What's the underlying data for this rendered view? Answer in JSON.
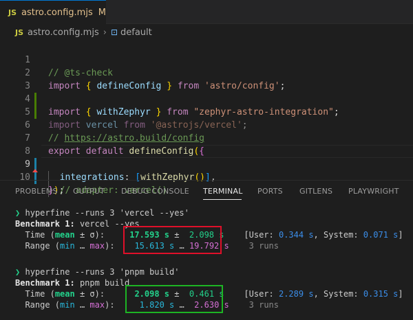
{
  "tab": {
    "name": "astro.config.mjs",
    "modified": "M",
    "js_icon": "JS",
    "close": "×"
  },
  "breadcrumb": {
    "file": "astro.config.mjs",
    "symbol": "default"
  },
  "editor": {
    "lines": [
      {
        "n": "1",
        "comment": "// @ts-check"
      },
      {
        "n": "2",
        "kw_import": "import",
        "brace_open": "{",
        "ident": "defineConfig",
        "brace_close": "}",
        "kw_from": "from",
        "str": "'astro/config'",
        "semi": ";"
      },
      {
        "n": "3",
        "kw_import": "import",
        "brace_open": "{",
        "ident": "withZephyr",
        "brace_close": "}",
        "kw_from": "from",
        "str": "\"zephyr-astro-integration\"",
        "semi": ";"
      },
      {
        "n": "4",
        "kw_import": "import",
        "ident": "vercel",
        "kw_from": "from",
        "str": "'@astrojs/vercel'",
        "semi": ";"
      },
      {
        "n": "5"
      },
      {
        "n": "6",
        "comment_prefix": "// ",
        "link": "https://astro.build/config"
      },
      {
        "n": "7",
        "kw_export": "export",
        "kw_default": "default",
        "fn": "defineConfig",
        "paren": "(",
        "brace": "{"
      },
      {
        "n": "8",
        "prop": "integrations",
        "colon": ": ",
        "bracket_open": "[",
        "fn": "withZephyr",
        "call": "()",
        "bracket_close": "]",
        "comma": ","
      },
      {
        "n": "9",
        "comment": "// adapter: vercel()"
      },
      {
        "n": "10",
        "brace": "}",
        "paren": ")",
        "semi": ";"
      }
    ]
  },
  "panel": {
    "tabs": [
      "PROBLEMS",
      "OUTPUT",
      "DEBUG CONSOLE",
      "TERMINAL",
      "PORTS",
      "GITLENS",
      "PLAYWRIGHT"
    ],
    "active": "TERMINAL"
  },
  "terminal": {
    "run1": {
      "prompt": "❯",
      "command": "hyperfine --runs 3 'vercel --yes'",
      "bench": "Benchmark 1:",
      "bench_name": "vercel --yes",
      "time_label": "Time (",
      "mean": "mean",
      "pm_sigma": " ± σ):",
      "mean_val": "17.593 s",
      "pm": " ± ",
      "sigma_val": " 2.098 s",
      "user_open": "[User: ",
      "user_val": "0.344 s",
      "sys_label": ", System: ",
      "sys_val": "0.071 s",
      "close": "]",
      "range_label": "Range (",
      "min": "min",
      "ellipsis": " … ",
      "max": "max",
      "range_close": "):",
      "min_val": "15.613 s",
      "max_val": "19.792 s",
      "runs": "3 runs"
    },
    "run2": {
      "prompt": "❯",
      "command": "hyperfine --runs 3 'pnpm build'",
      "bench": "Benchmark 1:",
      "bench_name": "pnpm build",
      "time_label": "Time (",
      "mean": "mean",
      "pm_sigma": " ± σ):",
      "mean_val": "2.098 s",
      "pm": " ± ",
      "sigma_val": " 0.461 s",
      "user_open": "[User: ",
      "user_val": "2.289 s",
      "sys_label": ", System: ",
      "sys_val": "0.315 s",
      "close": "]",
      "range_label": "Range (",
      "min": "min",
      "ellipsis": " … ",
      "max": "max",
      "range_close": "):",
      "min_val": "1.820 s",
      "max_val": "2.630 s",
      "runs": "3 runs"
    }
  },
  "colors": {
    "highlight_red": "#e0102a",
    "highlight_green": "#1db524",
    "gutter_modified": "#1b81a8",
    "gutter_added": "#487e02"
  }
}
